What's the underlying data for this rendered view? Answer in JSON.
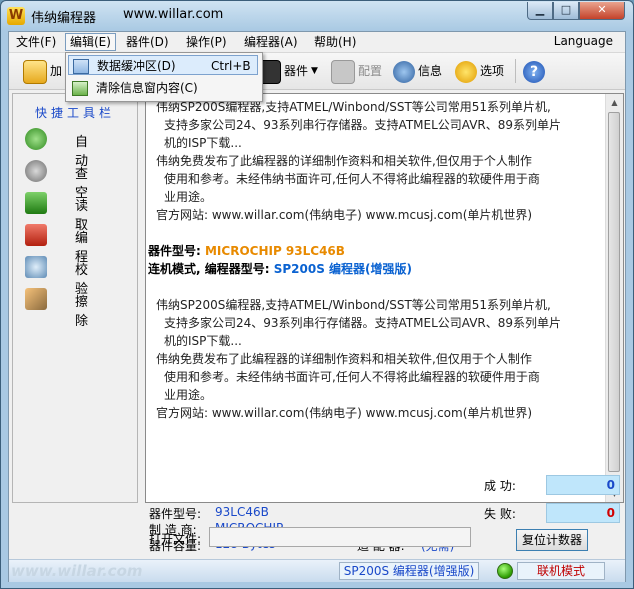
{
  "window": {
    "title": "伟纳编程器",
    "url": "www.willar.com"
  },
  "menu": [
    "文件(F)",
    "编辑(E)",
    "器件(D)",
    "操作(P)",
    "编程器(A)",
    "帮助(H)"
  ],
  "language": "Language",
  "toolbar": {
    "load": "加",
    "device": "器件",
    "config": "配置",
    "info": "信息",
    "options": "选项"
  },
  "dropdown": [
    {
      "label": "数据缓冲区(D)",
      "shortcut": "Ctrl+B"
    },
    {
      "label": "清除信息窗内容(C)"
    }
  ],
  "sidebar": {
    "title": "快捷工具栏",
    "items": [
      "自动",
      "查空",
      "读取",
      "编程",
      "校验",
      "擦除"
    ]
  },
  "output": {
    "para1": [
      "伟纳SP200S编程器,支持ATMEL/Winbond/SST等公司常用51系列单片机,",
      "支持多家公司24、93系列串行存储器。支持ATMEL公司AVR、89系列单片",
      "机的ISP下载...",
      "伟纳免费发布了此编程器的详细制作资料和相关软件,但仅用于个人制作",
      "使用和参考。未经伟纳书面许可,任何人不得将此编程器的软硬件用于商",
      "业用途。",
      "官方网站: www.willar.com(伟纳电子) www.mcusj.com(单片机世界)"
    ],
    "device_prefix": "器件型号: ",
    "device_name": "MICROCHIP   93LC46B",
    "mode_prefix": "连机模式, 编程器型号: ",
    "mode_name": "SP200S 编程器(增强版)",
    "para2": [
      "伟纳SP200S编程器,支持ATMEL/Winbond/SST等公司常用51系列单片机,",
      "支持多家公司24、93系列串行存储器。支持ATMEL公司AVR、89系列单片",
      "机的ISP下载...",
      "伟纳免费发布了此编程器的详细制作资料和相关软件,但仅用于个人制作",
      "使用和参考。未经伟纳书面许可,任何人不得将此编程器的软硬件用于商",
      "业用途。",
      "官方网站: www.willar.com(伟纳电子) www.mcusj.com(单片机世界)"
    ]
  },
  "info": {
    "model_label": "器件型号:",
    "model_value": "93LC46B",
    "maker_label": "制 造 商:",
    "maker_value": "MICROCHIP",
    "capacity_label": "器件容量:",
    "capacity_value": "128 Bytes",
    "adapter_label": "适 配 器:",
    "adapter_value": "(无需)"
  },
  "open_file_label": "打开文件:",
  "counters": {
    "success_label": "成  功:",
    "success_value": "0",
    "fail_label": "失  败:",
    "fail_value": "0",
    "reset": "复位计数器"
  },
  "status": {
    "url": "www.willar.com",
    "programmer": "SP200S 编程器(增强版)",
    "mode": "联机模式",
    "led_color": "#2b9b00"
  }
}
